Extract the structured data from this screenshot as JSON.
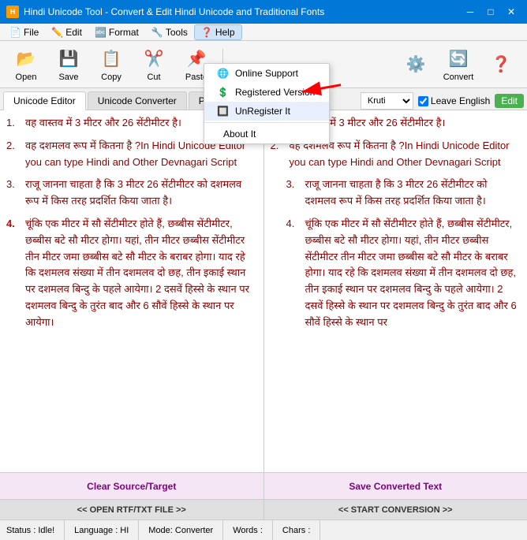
{
  "window": {
    "title": "Hindi Unicode Tool - Convert & Edit Hindi Unicode and Traditional Fonts",
    "icon": "H"
  },
  "menu": {
    "items": [
      {
        "id": "file",
        "label": "File",
        "icon": "📄"
      },
      {
        "id": "edit",
        "label": "Edit",
        "icon": "✏️"
      },
      {
        "id": "format",
        "label": "Format",
        "icon": "🔤"
      },
      {
        "id": "tools",
        "label": "Tools",
        "icon": "🔧"
      },
      {
        "id": "help",
        "label": "Help",
        "icon": "❓"
      }
    ]
  },
  "toolbar": {
    "buttons": [
      {
        "id": "open",
        "label": "Open",
        "icon": "📂"
      },
      {
        "id": "save",
        "label": "Save",
        "icon": "💾"
      },
      {
        "id": "copy",
        "label": "Copy",
        "icon": "📋"
      },
      {
        "id": "cut",
        "label": "Cut",
        "icon": "✂️"
      },
      {
        "id": "paste",
        "label": "Paste",
        "icon": "📌"
      }
    ],
    "right_buttons": [
      {
        "id": "convert_settings",
        "label": "",
        "icon": "⚙️"
      },
      {
        "id": "convert",
        "label": "Convert",
        "icon": "🔄"
      },
      {
        "id": "help_large",
        "label": "",
        "icon": "❓"
      }
    ]
  },
  "tabs": {
    "items": [
      {
        "id": "unicode-editor",
        "label": "Unicode Editor",
        "active": true
      },
      {
        "id": "unicode-converter",
        "label": "Unicode Converter",
        "active": false
      },
      {
        "id": "phone",
        "label": "Pho...",
        "active": false
      }
    ],
    "font_placeholder": "Kruti",
    "leave_english_label": "Leave English",
    "edit_label": "Edit"
  },
  "help_dropdown": {
    "items": [
      {
        "id": "online-support",
        "label": "Online Support",
        "icon": "🌐"
      },
      {
        "id": "registered-version",
        "label": "Registered Version",
        "icon": "💲"
      },
      {
        "id": "unregister-it",
        "label": "UnRegister It",
        "icon": "🔲",
        "highlighted": true
      },
      {
        "id": "about-it",
        "label": "About It",
        "icon": ""
      }
    ]
  },
  "left_pane": {
    "paragraphs": [
      {
        "num": "1.",
        "text": "वह वास्तव में 3 मीटर और 26 सेंटीमीटर है।"
      },
      {
        "num": "2.",
        "text": "वह दशमलव रूप में कितना है ?In Hindi Unicode Editor you can type Hindi and Other Devnagari Script"
      },
      {
        "num": "3.",
        "text": "राजू जानना चाहता है कि 3 मीटर 26 सेंटीमीटर को दशमलव रूप में किस तरह प्रदर्शित किया जाता है।"
      },
      {
        "num": "4.",
        "text": "चूंकि एक मीटर में सौ सेंटीमीटर होते हैं, छब्बीस सेंटीमीटर, छब्बीस बटे सौ मीटर होगा। यहां, तीन मीटर छब्बीस सेंटीमीटर तीन मीटर जमा छब्बीस बटे सौ मीटर के बराबर होगा। याद रहे कि दशमलव संख्या में तीन दशमलव दो छह, तीन इकाई स्थान पर दशमलव बिन्दु के पहले आयेगा। 2 दसवें हिस्से के स्थान पर दशमलव बिन्दु के तुरंत बाद और 6 सौवें हिस्से के स्थान पर आयेगा।"
      }
    ]
  },
  "right_pane": {
    "paragraphs": [
      {
        "num": "1.",
        "text": "वह वास्तव में 3 मीटर और 26 सेंटीमीटर है।"
      },
      {
        "num": "2.",
        "text": "वह दशमलव रूप में कितना है ?In Hindi Unicode Editor you can type Hindi and Other Devnagari Script"
      },
      {
        "num": "3.",
        "text": "राजू जानना चाहता है कि 3 मीटर 26 सेंटीमीटर को दशमलव रूप में किस तरह प्रदर्शित किया जाता है।"
      },
      {
        "num": "4.",
        "text": "चूंकि एक मीटर में सौ सेंटीमीटर होते हैं, छब्बीस सेंटीमीटर, छब्बीस बटे सौ मीटर होगा। यहां, तीन मीटर छब्बीस सेंटीमीटर  तीन मीटर जमा छब्बीस बटे सौ मीटर के बराबर होगा। याद रहे कि दशमलव संख्या में तीन दशमलव दो छह, तीन इकाई स्थान पर दशमलव बिन्दु के पहले आयेगा। 2 दसवें हिस्से के स्थान पर दशमलव बिन्दु के तुरंत बाद और 6 सौवें हिस्से के स्थान पर"
      }
    ]
  },
  "bottom": {
    "left_clear": "Clear Source/Target",
    "right_save": "Save Converted Text",
    "left_open": "<< OPEN RTF/TXT FILE >>",
    "right_start": "<< START CONVERSION >>"
  },
  "status_bar": {
    "status": "Status : Idle!",
    "language": "Language : HI",
    "mode": "Mode: Converter",
    "words": "Words :",
    "chars": "Chars :"
  }
}
